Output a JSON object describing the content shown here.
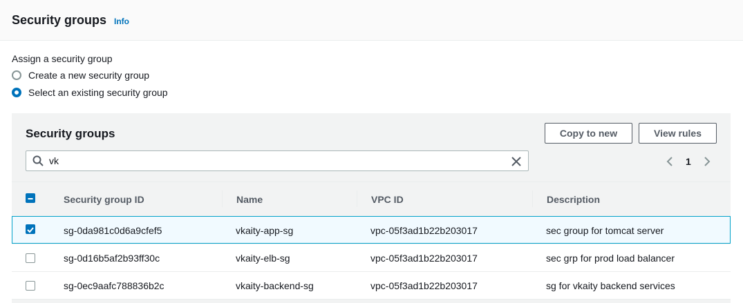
{
  "header": {
    "title": "Security groups",
    "info_link": "Info"
  },
  "assign": {
    "label": "Assign a security group",
    "options": [
      {
        "label": "Create a new security group",
        "checked": false
      },
      {
        "label": "Select an existing security group",
        "checked": true
      }
    ]
  },
  "panel": {
    "title": "Security groups",
    "copy_button": "Copy to new",
    "view_rules_button": "View rules",
    "search_value": "vk",
    "page_number": "1",
    "columns": [
      "Security group ID",
      "Name",
      "VPC ID",
      "Description"
    ],
    "rows": [
      {
        "id": "sg-0da981c0d6a9cfef5",
        "name": "vkaity-app-sg",
        "vpc": "vpc-05f3ad1b22b203017",
        "description": "sec group for tomcat server",
        "selected": true
      },
      {
        "id": "sg-0d16b5af2b93ff30c",
        "name": "vkaity-elb-sg",
        "vpc": "vpc-05f3ad1b22b203017",
        "description": "sec grp for prod load balancer",
        "selected": false
      },
      {
        "id": "sg-0ec9aafc788836b2c",
        "name": "vkaity-backend-sg",
        "vpc": "vpc-05f3ad1b22b203017",
        "description": "sg for vkaity backend services",
        "selected": false
      }
    ]
  },
  "colors": {
    "accent": "#0073bb",
    "selected_border": "#00a1c9",
    "selected_bg": "#f1faff"
  },
  "icons": {
    "search": "search-icon",
    "clear": "close-icon",
    "prev": "chevron-left-icon",
    "next": "chevron-right-icon"
  }
}
